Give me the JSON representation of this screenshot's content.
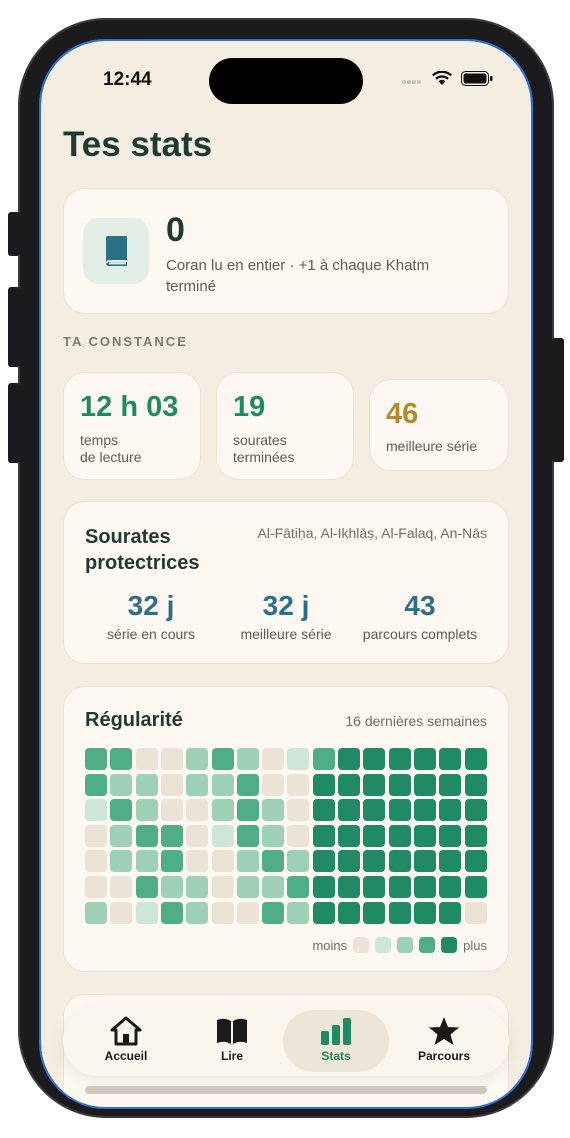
{
  "status_bar": {
    "time": "12:44"
  },
  "page": {
    "title": "Tes stats"
  },
  "khatm": {
    "count": "0",
    "description": "Coran lu en entier · +1 à chaque Khatm terminé",
    "icon": "book-icon"
  },
  "constance": {
    "section_label": "TA CONSTANCE",
    "stats": [
      {
        "value": "12 h 03",
        "label": "temps\nde lecture"
      },
      {
        "value": "19",
        "label": "sourates\nterminées"
      },
      {
        "value": "46",
        "label": "meilleure série"
      }
    ]
  },
  "protective": {
    "title": "Sourates protectrices",
    "surahs": "Al-Fātiḥa, Al-Ikhlāṣ, Al-Falaq, An-Nās",
    "stats": [
      {
        "value": "32 j",
        "label": "série en cours"
      },
      {
        "value": "32 j",
        "label": "meilleure série"
      },
      {
        "value": "43",
        "label": "parcours complets"
      }
    ]
  },
  "regularity": {
    "title": "Régularité",
    "subtitle": "16 dernières semaines",
    "legend_less": "moins",
    "legend_more": "plus",
    "levels_colors": [
      "#ebe4d6",
      "#cde6d8",
      "#9dd0b4",
      "#4fae85",
      "#1f8a63"
    ],
    "grid": [
      [
        3,
        3,
        0,
        0,
        2,
        3,
        2,
        0,
        1,
        3,
        4,
        4,
        4,
        4,
        4,
        4
      ],
      [
        3,
        2,
        2,
        0,
        2,
        2,
        3,
        0,
        0,
        4,
        4,
        4,
        4,
        4,
        4,
        4
      ],
      [
        1,
        3,
        2,
        0,
        0,
        2,
        3,
        2,
        0,
        4,
        4,
        4,
        4,
        4,
        4,
        4
      ],
      [
        0,
        2,
        3,
        3,
        0,
        1,
        3,
        2,
        0,
        4,
        4,
        4,
        4,
        4,
        4,
        4
      ],
      [
        0,
        2,
        2,
        3,
        0,
        0,
        2,
        3,
        2,
        4,
        4,
        4,
        4,
        4,
        4,
        4
      ],
      [
        0,
        0,
        3,
        2,
        2,
        0,
        2,
        2,
        3,
        4,
        4,
        4,
        4,
        4,
        4,
        4
      ],
      [
        2,
        0,
        1,
        3,
        2,
        0,
        0,
        3,
        2,
        4,
        4,
        4,
        4,
        4,
        4,
        0
      ]
    ]
  },
  "tabbar": {
    "items": [
      {
        "label": "Accueil",
        "icon": "home-icon"
      },
      {
        "label": "Lire",
        "icon": "open-book-icon"
      },
      {
        "label": "Stats",
        "icon": "bar-chart-icon"
      },
      {
        "label": "Parcours",
        "icon": "star-icon"
      }
    ],
    "active": "Stats"
  }
}
